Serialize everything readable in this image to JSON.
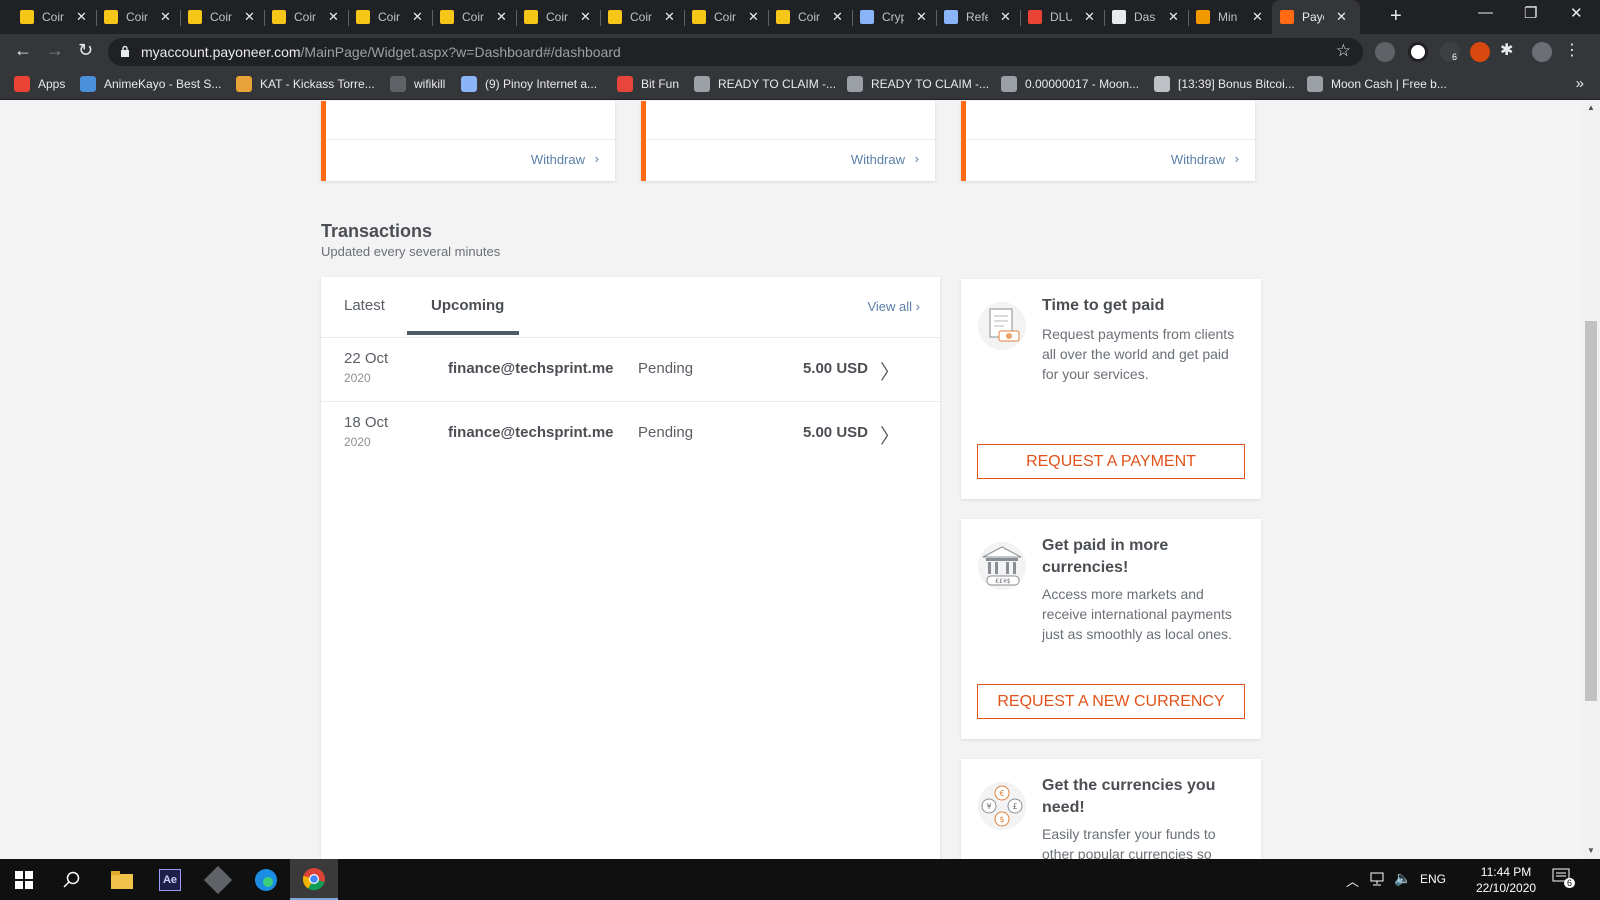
{
  "browser": {
    "tabs": [
      {
        "label": "Coin",
        "icon": "coin-icon",
        "color": "#f5c518"
      },
      {
        "label": "Coin",
        "icon": "coin-icon",
        "color": "#f5c518"
      },
      {
        "label": "Coin",
        "icon": "coin-icon",
        "color": "#f5c518"
      },
      {
        "label": "Coin",
        "icon": "coin-icon",
        "color": "#f5c518"
      },
      {
        "label": "Coin",
        "icon": "coin-icon",
        "color": "#f5c518"
      },
      {
        "label": "Coin",
        "icon": "coin-icon",
        "color": "#f5c518"
      },
      {
        "label": "Coin",
        "icon": "coin-icon",
        "color": "#f5c518"
      },
      {
        "label": "Coin",
        "icon": "coin-icon",
        "color": "#f5c518"
      },
      {
        "label": "Coin",
        "icon": "coin-icon",
        "color": "#f5c518"
      },
      {
        "label": "Coin",
        "icon": "coin-icon",
        "color": "#f5c518"
      },
      {
        "label": "Cryp",
        "icon": "shield-icon",
        "color": "#8ab4f8"
      },
      {
        "label": "Refe",
        "icon": "shield-icon",
        "color": "#8ab4f8"
      },
      {
        "label": "DLU",
        "icon": "gmail-icon",
        "color": "#ea4335"
      },
      {
        "label": "Das",
        "icon": "globe-icon",
        "color": "#e8eaed"
      },
      {
        "label": "Min",
        "icon": "flame-icon",
        "color": "#f29900"
      },
      {
        "label": "Payo",
        "icon": "payoneer-icon",
        "color": "#ff6a13"
      }
    ],
    "new_tab": "+",
    "window_controls": {
      "minimize": "—",
      "restore": "❐",
      "close": "✕"
    },
    "nav": {
      "back": "←",
      "forward": "→",
      "reload": "↻"
    },
    "url_host": "myaccount.payoneer.com",
    "url_path": "/MainPage/Widget.aspx?w=Dashboard#/dashboard",
    "star": "☆",
    "extensions_badge": "6",
    "bookmarks": [
      {
        "label": "Apps",
        "color": "#ea4335"
      },
      {
        "label": "AnimeKayo - Best S...",
        "color": "#4a90d9"
      },
      {
        "label": "KAT - Kickass Torre...",
        "color": "#e8a33b"
      },
      {
        "label": "wifikill",
        "color": "#5f6368"
      },
      {
        "label": "(9) Pinoy Internet a...",
        "color": "#8ab4f8"
      },
      {
        "label": "Bit Fun",
        "color": "#e8453c"
      },
      {
        "label": "READY TO CLAIM -...",
        "color": "#9aa0a6"
      },
      {
        "label": "READY TO CLAIM -...",
        "color": "#9aa0a6"
      },
      {
        "label": "0.00000017 - Moon...",
        "color": "#9aa0a6"
      },
      {
        "label": "[13:39] Bonus Bitcoi...",
        "color": "#bdc1c6"
      },
      {
        "label": "Moon Cash | Free b...",
        "color": "#9aa0a6"
      }
    ],
    "bookmarks_more": "»"
  },
  "page": {
    "withdraw_cards": [
      {
        "link": "Withdraw"
      },
      {
        "link": "Withdraw"
      },
      {
        "link": "Withdraw"
      }
    ],
    "chevron": "›",
    "transactions": {
      "title": "Transactions",
      "subtitle": "Updated every several minutes",
      "tab_latest": "Latest",
      "tab_upcoming": "Upcoming",
      "view_all": "View all",
      "rows": [
        {
          "day": "22 Oct",
          "year": "2020",
          "payee": "finance@techsprint.me",
          "status": "Pending",
          "amount": "5.00 USD"
        },
        {
          "day": "18 Oct",
          "year": "2020",
          "payee": "finance@techsprint.me",
          "status": "Pending",
          "amount": "5.00 USD"
        }
      ],
      "row_chevron": "〉"
    },
    "promos": [
      {
        "title": "Time to get paid",
        "text": "Request payments from clients all over the world and get paid for your services.",
        "button": "REQUEST A PAYMENT",
        "icon": "invoice-icon"
      },
      {
        "title": "Get paid in more currencies!",
        "text": "Access more markets and receive international payments just as smoothly as local ones.",
        "button": "REQUEST A NEW CURRENCY",
        "icon": "bank-icon",
        "icon_text": "€£¥$"
      },
      {
        "title": "Get the currencies you need!",
        "text": "Easily transfer your funds to other popular currencies so",
        "icon": "currency-exchange-icon",
        "icon_symbols": [
          "€",
          "¥",
          "£",
          "$"
        ]
      }
    ],
    "accent_color": "#ff6a13",
    "button_color": "#e0521a"
  },
  "taskbar": {
    "language": "ENG",
    "time": "11:44 PM",
    "date": "22/10/2020",
    "notification_count": "6",
    "apps": [
      "windows-start-icon",
      "search-icon",
      "file-explorer-icon",
      "after-effects-icon",
      "app-icon",
      "edge-icon",
      "chrome-icon"
    ],
    "ae_label": "Ae"
  }
}
